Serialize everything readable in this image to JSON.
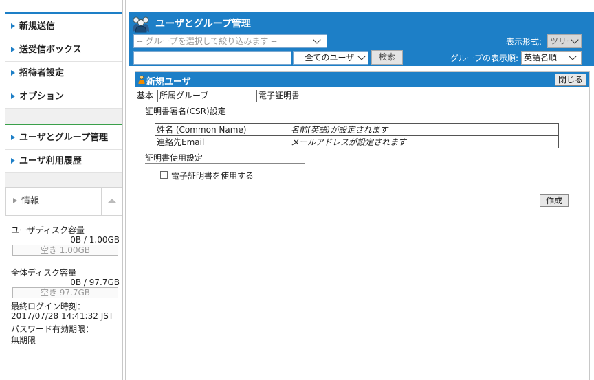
{
  "sidebar": {
    "items": [
      {
        "label": "新規送信"
      },
      {
        "label": "送受信ボックス"
      },
      {
        "label": "招待者設定"
      },
      {
        "label": "オプション"
      },
      {
        "label": "ユーザとグループ管理"
      },
      {
        "label": "ユーザ利用履歴"
      }
    ],
    "info": {
      "title": "情報",
      "user_disk_label": "ユーザディスク容量",
      "user_disk_value": "0B / 1.00GB",
      "user_disk_free": "空き 1.00GB",
      "total_disk_label": "全体ディスク容量",
      "total_disk_value": "0B / 97.7GB",
      "total_disk_free": "空き 97.7GB",
      "last_login_label": "最終ログイン時刻：",
      "last_login_value": "2017/07/28 14:41:32 JST",
      "password_expiry_label": "パスワード有効期限：",
      "password_expiry_value": "無期限"
    }
  },
  "header": {
    "title": "ユーザとグループ管理",
    "group_select": "-- グループを選択して絞り込みます --",
    "search_value": "",
    "user_select": "-- 全てのユーザ --",
    "search_button": "検索",
    "format_label": "表示形式:",
    "format_value": "ツリー",
    "order_label": "グループの表示順:",
    "order_value": "英語名順"
  },
  "panel": {
    "title": "新規ユーザ",
    "close_button": "閉じる",
    "tabs": [
      {
        "label": "基本"
      },
      {
        "label": "所属グループ"
      },
      {
        "label": "電子証明書"
      }
    ],
    "csr_title": "証明書署名(CSR)設定",
    "csr_rows": [
      {
        "key": "姓名 (Common Name)",
        "value": "名前(英語)が設定されます"
      },
      {
        "key": "連絡先Email",
        "value": "メールアドレスが設定されます"
      }
    ],
    "usage_title": "証明書使用設定",
    "use_cert_label": "電子証明書を使用する",
    "create_button": "作成"
  },
  "colors": {
    "accent": "#1d7fc7",
    "separator": "#3aa04a"
  }
}
